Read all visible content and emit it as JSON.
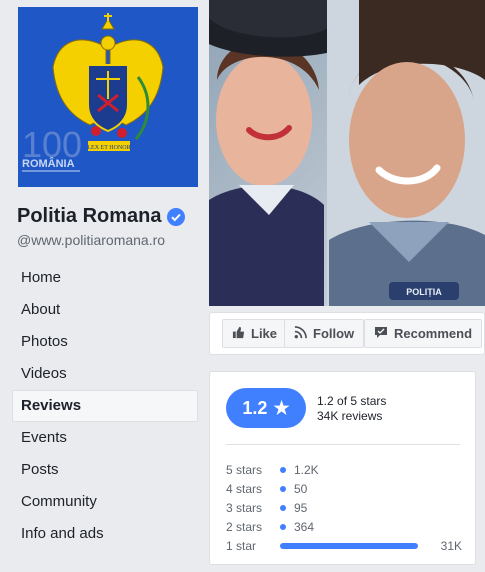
{
  "page": {
    "name": "Politia Romana",
    "handle": "@www.politiaromana.ro",
    "verified_icon": "verified-badge-icon",
    "profile_logo_text": [
      "100",
      "ROMÂNIA",
      "LEX ET HONOR"
    ],
    "colors": {
      "profile_bg": "#1f58c6",
      "accent": "#4080ff"
    }
  },
  "nav": {
    "items": [
      {
        "label": "Home"
      },
      {
        "label": "About"
      },
      {
        "label": "Photos"
      },
      {
        "label": "Videos"
      },
      {
        "label": "Reviews",
        "active": true
      },
      {
        "label": "Events"
      },
      {
        "label": "Posts"
      },
      {
        "label": "Community"
      },
      {
        "label": "Info and ads"
      }
    ]
  },
  "actions": {
    "like_label": "Like",
    "follow_label": "Follow",
    "recommend_label": "Recommend"
  },
  "reviews": {
    "rating": "1.2",
    "rating_star": "★",
    "rating_text": "1.2 of 5 stars",
    "review_count": "34K reviews",
    "distribution": [
      {
        "label": "5 stars",
        "count": "1.2K",
        "fraction": 0.04
      },
      {
        "label": "4 stars",
        "count": "50",
        "fraction": 0.002
      },
      {
        "label": "3 stars",
        "count": "95",
        "fraction": 0.003
      },
      {
        "label": "2 stars",
        "count": "364",
        "fraction": 0.011
      },
      {
        "label": "1 star",
        "count": "31K",
        "fraction": 0.92
      }
    ]
  }
}
